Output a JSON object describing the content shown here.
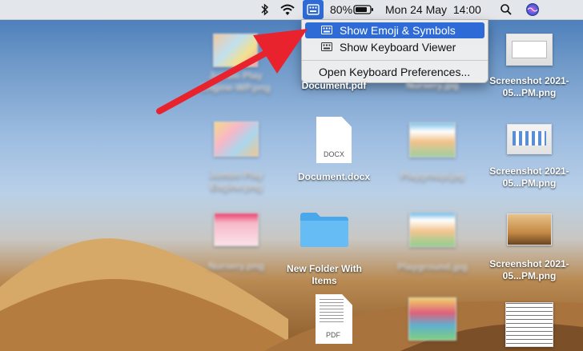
{
  "menubar": {
    "battery": "80%",
    "datetime": "Mon 24 May  14:00",
    "icons": [
      "bluetooth-icon",
      "wifi-icon",
      "input-source-icon",
      "battery-icon",
      "spotlight-icon",
      "siri-icon"
    ]
  },
  "input_menu": {
    "items": [
      {
        "label": "Show Emoji & Symbols",
        "selected": true
      },
      {
        "label": "Show Keyboard Viewer",
        "selected": false
      },
      {
        "label": "Open Keyboard Preferences...",
        "selected": false
      }
    ]
  },
  "desktop": {
    "files": [
      {
        "label": "Jumbo Play Engine-WP.png"
      },
      {
        "label": "Document.pdf"
      },
      {
        "label": "Nursery.jpg"
      },
      {
        "label": "Screenshot 2021-05...PM.png"
      },
      {
        "label": "Jumbo Play Engine.png"
      },
      {
        "label": "Document.docx",
        "badge": "DOCX"
      },
      {
        "label": "Playgroup.jpg"
      },
      {
        "label": "Screenshot 2021-05...PM.png"
      },
      {
        "label": "Nursery.png"
      },
      {
        "label": "New Folder With Items"
      },
      {
        "label": "Playground.jpg"
      },
      {
        "label": "Screenshot 2021-05...PM.png"
      },
      {
        "label": "",
        "badge": "PDF"
      }
    ]
  },
  "colors": {
    "accent": "#2e6bd6",
    "arrow": "#e8232e"
  }
}
